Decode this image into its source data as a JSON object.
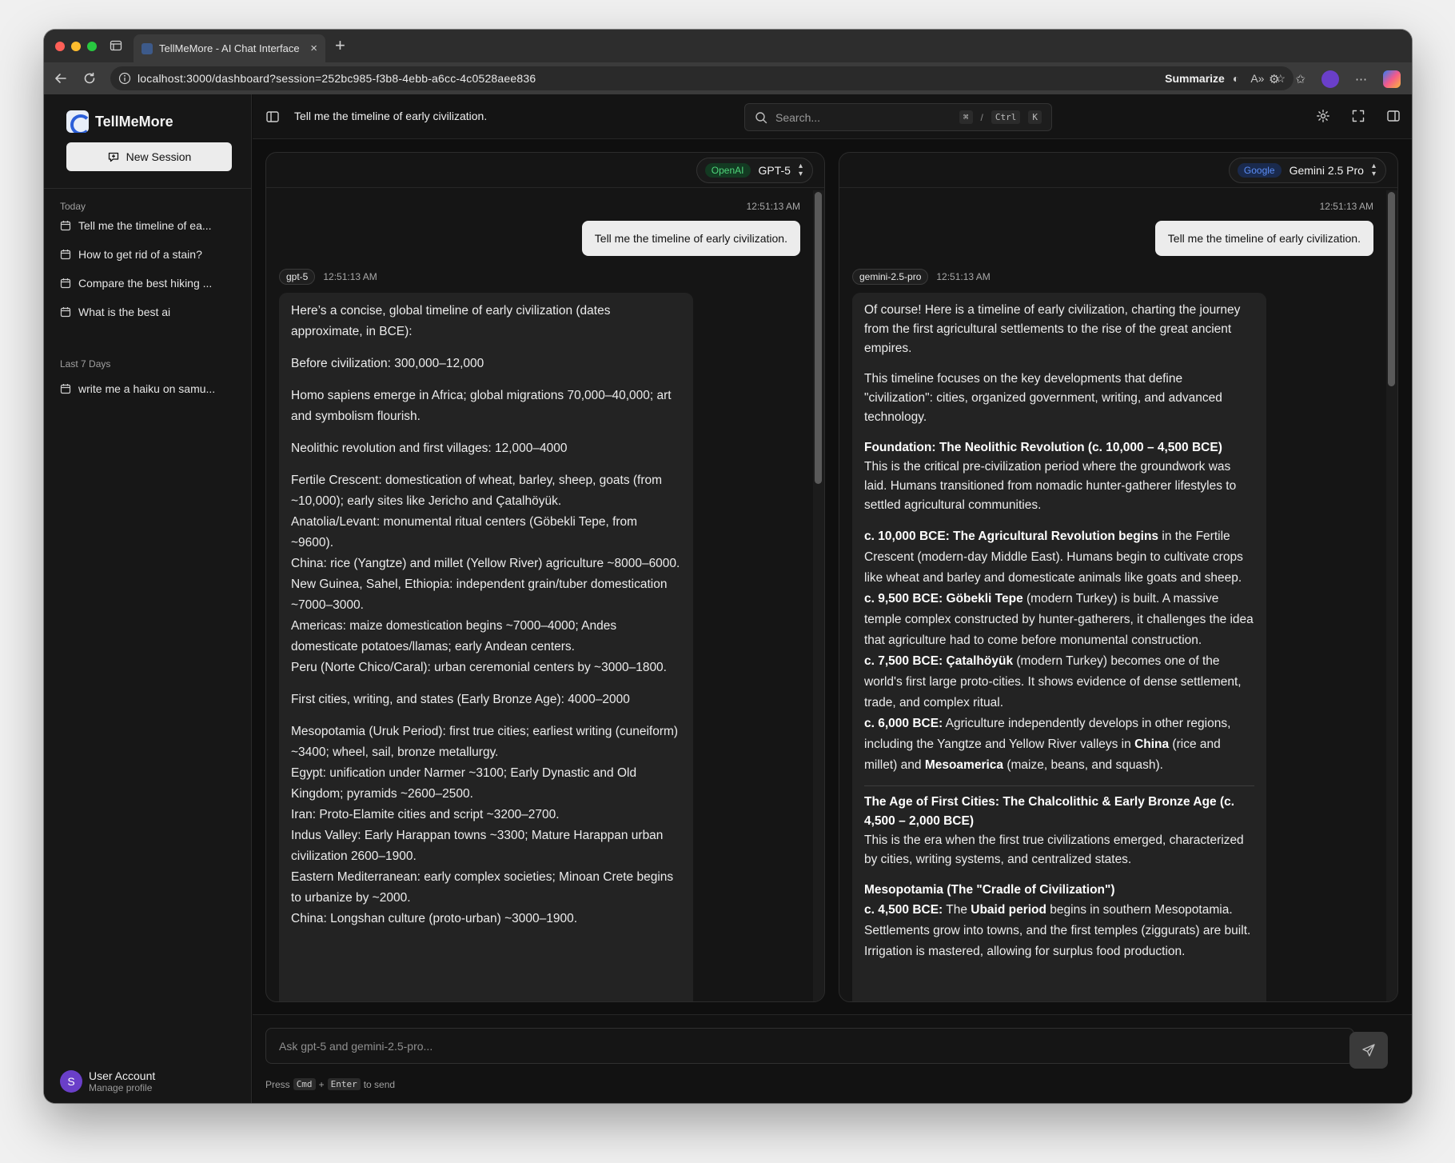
{
  "browser": {
    "tab_title": "TellMeMore - AI Chat Interface",
    "url": "localhost:3000/dashboard?session=252bc985-f3b8-4ebb-a6cc-4c0528aee836",
    "summarize_label": "Summarize"
  },
  "sidebar": {
    "brand": "TellMeMore",
    "new_session_label": "New Session",
    "sections": [
      {
        "label": "Today",
        "items": [
          {
            "label": "Tell me the timeline of ea..."
          },
          {
            "label": "How to get rid of a stain?"
          },
          {
            "label": "Compare the best hiking ..."
          },
          {
            "label": "What is the best ai"
          }
        ]
      },
      {
        "label": "Last 7 Days",
        "items": [
          {
            "label": "write me a haiku on samu..."
          }
        ]
      }
    ],
    "user": {
      "initial": "S",
      "name": "User Account",
      "subtitle": "Manage profile"
    }
  },
  "topbar": {
    "title": "Tell me the timeline of early civilization.",
    "search_placeholder": "Search...",
    "shortcut": {
      "cmd": "⌘",
      "sep": "/",
      "ctrl": "Ctrl",
      "key": "K"
    }
  },
  "panels": [
    {
      "provider": "OpenAI",
      "provider_color": "#4fd57a",
      "model": "GPT-5",
      "user_time": "12:51:13 AM",
      "user_message": "Tell me the timeline of early civilization.",
      "assistant_label": "gpt-5",
      "assistant_time": "12:51:13 AM",
      "lines": [
        "Here’s a concise, global timeline of early civilization (dates approximate, in BCE):",
        "Before civilization: 300,000–12,000",
        "Homo sapiens emerge in Africa; global migrations 70,000–40,000; art and symbolism flourish.",
        "Neolithic revolution and first villages: 12,000–4000",
        "Fertile Crescent: domestication of wheat, barley, sheep, goats (from ~10,000); early sites like Jericho and Çatalhöyük.",
        "Anatolia/Levant: monumental ritual centers (Göbekli Tepe, from ~9600).",
        "China: rice (Yangtze) and millet (Yellow River) agriculture ~8000–6000.",
        "New Guinea, Sahel, Ethiopia: independent grain/tuber domestication ~7000–3000.",
        "Americas: maize domestication begins ~7000–4000; Andes domesticate potatoes/llamas; early Andean centers.",
        "Peru (Norte Chico/Caral): urban ceremonial centers by ~3000–1800.",
        "First cities, writing, and states (Early Bronze Age): 4000–2000",
        "Mesopotamia (Uruk Period): first true cities; earliest writing (cuneiform) ~3400; wheel, sail, bronze metallurgy.",
        "Egypt: unification under Narmer ~3100; Early Dynastic and Old Kingdom; pyramids ~2600–2500.",
        "Iran: Proto-Elamite cities and script ~3200–2700.",
        "Indus Valley: Early Harappan towns ~3300; Mature Harappan urban civilization 2600–1900.",
        "Eastern Mediterranean: early complex societies; Minoan Crete begins to urbanize by ~2000.",
        "China: Longshan culture (proto-urban) ~3000–1900."
      ]
    },
    {
      "provider": "Google",
      "provider_color": "#5b8df5",
      "model": "Gemini 2.5 Pro",
      "user_time": "12:51:13 AM",
      "user_message": "Tell me the timeline of early civilization.",
      "assistant_label": "gemini-2.5-pro",
      "assistant_time": "12:51:13 AM",
      "intro": "Of course! Here is a timeline of early civilization, charting the journey from the first agricultural settlements to the rise of the great ancient empires.",
      "focus": "This timeline focuses on the key developments that define \"civilization\": cities, organized government, writing, and advanced technology.",
      "section1": {
        "heading": "Foundation: The Neolithic Revolution (c. 10,000 – 4,500 BCE)",
        "body": "This is the critical pre-civilization period where the groundwork was laid. Humans transitioned from nomadic hunter-gatherer lifestyles to settled agricultural communities."
      },
      "items": [
        {
          "bold": "c. 10,000 BCE: The Agricultural Revolution begins",
          "text": " in the Fertile Crescent (modern-day Middle East). Humans begin to cultivate crops like wheat and barley and domesticate animals like goats and sheep."
        },
        {
          "bold": "c. 9,500 BCE: Göbekli Tepe",
          "text": " (modern Turkey) is built. A massive temple complex constructed by hunter-gatherers, it challenges the idea that agriculture had to come before monumental construction."
        },
        {
          "bold": "c. 7,500 BCE: Çatalhöyük",
          "text": " (modern Turkey) becomes one of the world's first large proto-cities. It shows evidence of dense settlement, trade, and complex ritual."
        }
      ],
      "item4": {
        "bold": "c. 6,000 BCE:",
        "text1": " Agriculture independently develops in other regions, including the Yangtze and Yellow River valleys in ",
        "china": "China",
        "text2": " (rice and millet) and ",
        "meso": "Mesoamerica",
        "text3": " (maize, beans, and squash)."
      },
      "section2": {
        "heading": "The Age of First Cities: The Chalcolithic & Early Bronze Age (c. 4,500 – 2,000 BCE)",
        "body": "This is the era when the first true civilizations emerged, characterized by cities, writing systems, and centralized states."
      },
      "section3": {
        "heading": "Mesopotamia (The \"Cradle of Civilization\")"
      },
      "item5": {
        "bold": "c. 4,500 BCE:",
        "text1": " The ",
        "ubaid": "Ubaid period",
        "text2": " begins in southern Mesopotamia. Settlements grow into towns, and the first temples (ziggurats) are built. Irrigation is mastered, allowing for surplus food production."
      }
    }
  ],
  "composer": {
    "placeholder": "Ask gpt-5 and gemini-2.5-pro...",
    "hint_press": "Press",
    "hint_cmd": "Cmd",
    "hint_plus": "+",
    "hint_enter": "Enter",
    "hint_tail": "to send"
  }
}
